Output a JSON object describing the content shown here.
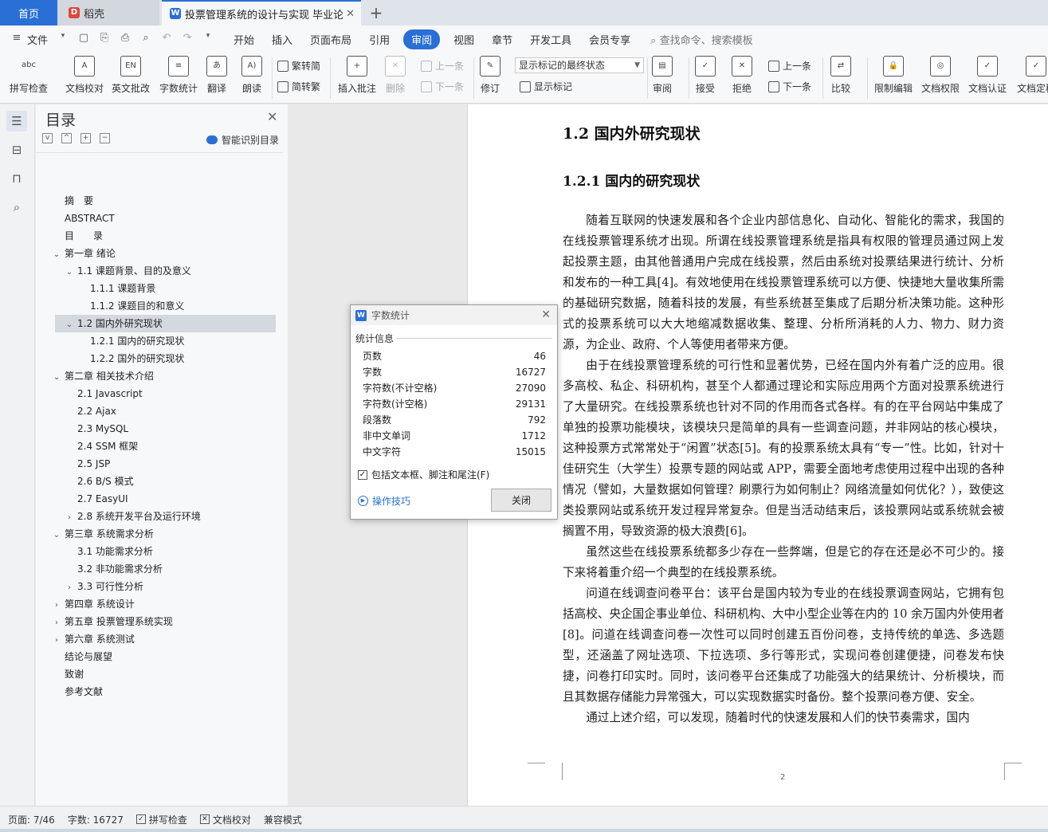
{
  "tabs": {
    "home": "首页",
    "straw": "稻壳",
    "doc": "投票管理系统的设计与实现 毕业论文",
    "close": "✕",
    "plus": "+"
  },
  "menu": {
    "file": "文件",
    "items": [
      "开始",
      "插入",
      "页面布局",
      "引用",
      "审阅",
      "视图",
      "章节",
      "开发工具",
      "会员专享"
    ],
    "active_index": 4,
    "search": "查找命令、搜索模板"
  },
  "ribbon": {
    "spell": "拼写检查",
    "proof": "文档校对",
    "en_review": "英文批改",
    "wordcount": "字数统计",
    "translate": "翻译",
    "read": "朗读",
    "trad": "繁转简",
    "simp": "简转繁",
    "insert_comment": "插入批注",
    "delete": "删除",
    "prev": "上一条",
    "next": "下一条",
    "track": "修订",
    "markup_state": "显示标记的最终状态",
    "show_markup": "显示标记",
    "review": "审阅",
    "accept": "接受",
    "reject": "拒绝",
    "prev2": "上一条",
    "next2": "下一条",
    "compare": "比较",
    "restrict": "限制编辑",
    "permission": "文档权限",
    "certify": "文档认证",
    "finalize": "文档定稿"
  },
  "toc": {
    "title": "目录",
    "smart": "智能识别目录",
    "items": [
      {
        "label": "摘　要",
        "level": 0,
        "chev": ""
      },
      {
        "label": "ABSTRACT",
        "level": 0,
        "chev": ""
      },
      {
        "label": "目　　录",
        "level": 0,
        "chev": ""
      },
      {
        "label": "第一章  绪论",
        "level": 0,
        "chev": "v"
      },
      {
        "label": "1.1  课题背景、目的及意义",
        "level": 1,
        "chev": "v"
      },
      {
        "label": "1.1.1  课题背景",
        "level": 2,
        "chev": ""
      },
      {
        "label": "1.1.2  课题目的和意义",
        "level": 2,
        "chev": ""
      },
      {
        "label": "1.2  国内外研究现状",
        "level": 1,
        "chev": "v",
        "selected": true
      },
      {
        "label": "1.2.1  国内的研究现状",
        "level": 2,
        "chev": ""
      },
      {
        "label": "1.2.2  国外的研究现状",
        "level": 2,
        "chev": ""
      },
      {
        "label": "第二章  相关技术介绍",
        "level": 0,
        "chev": "v"
      },
      {
        "label": "2.1 Javascript",
        "level": 1,
        "chev": ""
      },
      {
        "label": "2.2 Ajax",
        "level": 1,
        "chev": ""
      },
      {
        "label": "2.3 MySQL",
        "level": 1,
        "chev": ""
      },
      {
        "label": "2.4 SSM 框架",
        "level": 1,
        "chev": ""
      },
      {
        "label": "2.5 JSP",
        "level": 1,
        "chev": ""
      },
      {
        "label": "2.6 B/S 模式",
        "level": 1,
        "chev": ""
      },
      {
        "label": "2.7 EasyUI",
        "level": 1,
        "chev": ""
      },
      {
        "label": "2.8  系统开发平台及运行环境",
        "level": 1,
        "chev": ">"
      },
      {
        "label": "第三章  系统需求分析",
        "level": 0,
        "chev": "v"
      },
      {
        "label": "3.1  功能需求分析",
        "level": 1,
        "chev": ""
      },
      {
        "label": "3.2  非功能需求分析",
        "level": 1,
        "chev": ""
      },
      {
        "label": "3.3  可行性分析",
        "level": 1,
        "chev": ">"
      },
      {
        "label": "第四章  系统设计",
        "level": 0,
        "chev": ">"
      },
      {
        "label": "第五章  投票管理系统实现",
        "level": 0,
        "chev": ">"
      },
      {
        "label": "第六章  系统测试",
        "level": 0,
        "chev": ">"
      },
      {
        "label": "结论与展望",
        "level": 0,
        "chev": ""
      },
      {
        "label": "致谢",
        "level": 0,
        "chev": ""
      },
      {
        "label": "参考文献",
        "level": 0,
        "chev": ""
      }
    ]
  },
  "document": {
    "h2": "1.2  国内外研究现状",
    "h3": "1.2.1  国内的研究现状",
    "paragraphs": [
      "随着互联网的快速发展和各个企业内部信息化、自动化、智能化的需求，我国的在线投票管理系统才出现。所谓在线投票管理系统是指具有权限的管理员通过网上发起投票主题，由其他普通用户完成在线投票，然后由系统对投票结果进行统计、分析和发布的一种工具[4]。有效地使用在线投票管理系统可以方便、快捷地大量收集所需的基础研究数据，随着科技的发展，有些系统甚至集成了后期分析决策功能。这种形式的投票系统可以大大地缩减数据收集、整理、分析所消耗的人力、物力、财力资源，为企业、政府、个人等使用者带来方便。",
      "由于在线投票管理系统的可行性和显著优势，已经在国内外有着广泛的应用。很多高校、私企、科研机构，甚至个人都通过理论和实际应用两个方面对投票系统进行了大量研究。在线投票系统也针对不同的作用而各式各样。有的在平台网站中集成了单独的投票功能模块，该模块只是简单的具有一些调查问题，并非网站的核心模块，这种投票方式常常处于“闲置”状态[5]。有的投票系统太具有“专一”性。比如，针对十佳研究生（大学生）投票专题的网站或 APP，需要全面地考虑使用过程中出现的各种情况（譬如，大量数据如何管理？刷票行为如何制止？网络流量如何优化？），致使这类投票网站或系统开发过程异常复杂。但是当活动结束后，该投票网站或系统就会被搁置不用，导致资源的极大浪费[6]。",
      "虽然这些在线投票系统都多少存在一些弊端，但是它的存在还是必不可少的。接下来将着重介绍一个典型的在线投票系统。",
      "问道在线调查问卷平台：该平台是国内较为专业的在线投票调查网站，它拥有包括高校、央企国企事业单位、科研机构、大中小型企业等在内的 10 余万国内外使用者[8]。问道在线调查问卷一次性可以同时创建五百份问卷，支持传统的单选、多选题型，还涵盖了网址选项、下拉选项、多行等形式，实现问卷创建便捷，问卷发布快捷，问卷打印实时。同时，该问卷平台还集成了功能强大的结果统计、分析模块，而且其数据存储能力异常强大，可以实现数据实时备份。整个投票问卷方便、安全。",
      "通过上述介绍，可以发现，随着时代的快速发展和人们的快节奏需求，国内"
    ],
    "page_number": "2"
  },
  "dialog": {
    "title": "字数统计",
    "section": "统计信息",
    "stats": [
      {
        "label": "页数",
        "value": "46"
      },
      {
        "label": "字数",
        "value": "16727"
      },
      {
        "label": "字符数(不计空格)",
        "value": "27090"
      },
      {
        "label": "字符数(计空格)",
        "value": "29131"
      },
      {
        "label": "段落数",
        "value": "792"
      },
      {
        "label": "非中文单词",
        "value": "1712"
      },
      {
        "label": "中文字符",
        "value": "15015"
      }
    ],
    "checkbox": "包括文本框、脚注和尾注(F)",
    "checked": true,
    "tips": "操作技巧",
    "close_btn": "关闭"
  },
  "status": {
    "page": "页面: 7/46",
    "words": "字数: 16727",
    "spell": "拼写检查",
    "proof": "文档校对",
    "compat": "兼容模式"
  },
  "colors": {
    "accent": "#2a6fd6"
  }
}
